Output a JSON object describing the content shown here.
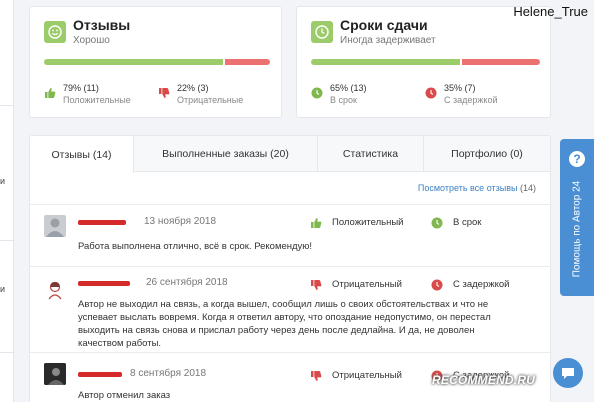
{
  "username": "Helene_True",
  "reviews_card": {
    "title": "Отзывы",
    "subtitle": "Хорошо",
    "positive_share": 0.79,
    "positive_pct": "79% (11)",
    "positive_label": "Положительные",
    "negative_pct": "22% (3)",
    "negative_label": "Отрицательные"
  },
  "deadline_card": {
    "title": "Сроки сдачи",
    "subtitle": "Иногда задерживает",
    "ontime_share": 0.65,
    "ontime_pct": "65% (13)",
    "ontime_label": "В срок",
    "late_pct": "35% (7)",
    "late_label": "С задержкой"
  },
  "tabs": [
    {
      "label": "Отзывы (14)"
    },
    {
      "label": "Выполненные заказы (20)"
    },
    {
      "label": "Статистика"
    },
    {
      "label": "Портфолио (0)"
    }
  ],
  "see_all": {
    "label": "Посмотреть все отзывы",
    "count": "(14)"
  },
  "reviews": [
    {
      "date": "13 ноября 2018",
      "rating": "Положительный",
      "timing": "В срок",
      "text": "Работа выполнена отлично, всё в срок. Рекомендую!"
    },
    {
      "date": "26 сентября 2018",
      "rating": "Отрицательный",
      "timing": "С задержкой",
      "text": "Автор не выходил на связь, а когда вышел, сообщил лишь о своих обстоятельствах и что не успевает выслать вовремя. Когда я ответил автору, что опоздание недопустимо, он перестал выходить на связь снова и прислал работу через день после дедлайна. И да, не доволен качеством работы."
    },
    {
      "date": "8 сентября 2018",
      "rating": "Отрицательный",
      "timing": "С задержкой",
      "text": "Автор отменил заказ"
    }
  ],
  "help_tab": {
    "label": "Помощь по Автор 24",
    "icon": "question-icon"
  },
  "watermark": "RECOMMEND.RU",
  "colors": {
    "positive": "#9ccb6a",
    "negative": "#ec7272",
    "accent": "#4a8fd4"
  }
}
